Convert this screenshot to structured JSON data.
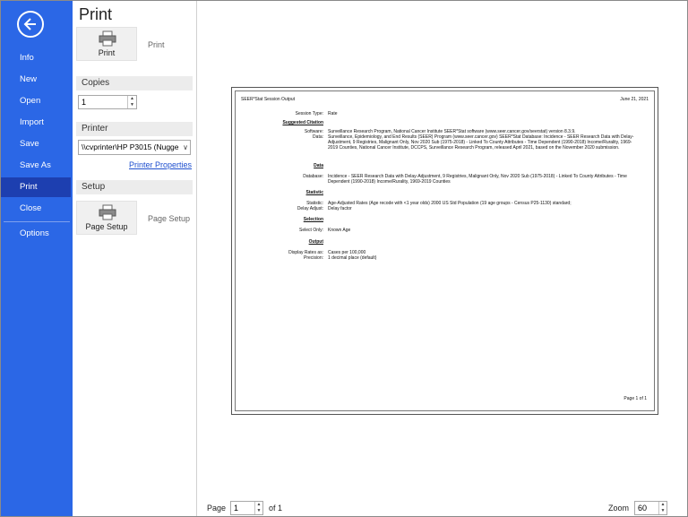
{
  "nav": {
    "items": [
      {
        "label": "Info"
      },
      {
        "label": "New"
      },
      {
        "label": "Open"
      },
      {
        "label": "Import"
      },
      {
        "label": "Save"
      },
      {
        "label": "Save As"
      },
      {
        "label": "Print",
        "active": true
      },
      {
        "label": "Close"
      },
      {
        "label": "Options"
      }
    ],
    "back_icon": "back-arrow-icon"
  },
  "panel": {
    "title": "Print",
    "print_button": "Print",
    "print_side_label": "Print",
    "copies_header": "Copies",
    "copies_value": "1",
    "printer_header": "Printer",
    "printer_selected": "\\\\cvprinter\\HP P3015 (Nugge",
    "printer_properties": "Printer Properties",
    "setup_header": "Setup",
    "page_setup_button": "Page Setup",
    "page_setup_side_label": "Page Setup"
  },
  "preview": {
    "page_header_left": "SEER*Stat Session Output",
    "page_header_right": "June 21, 2021",
    "session_type_label": "Session Type:",
    "session_type_value": "Rate",
    "suggested_citation": "Suggested Citation",
    "software_label": "Software:",
    "software_value": "Surveillance Research Program, National Cancer Institute SEER*Stat software (www.seer.cancer.gov/seerstat) version 8.3.9.",
    "data_label": "Data:",
    "data_value": "Surveillance, Epidemiology, and End Results (SEER) Program (www.seer.cancer.gov) SEER*Stat Database: Incidence - SEER Research Data with Delay-Adjustment, 9 Registries, Malignant Only, Nov 2020 Sub (1975-2018) - Linked To County Attributes - Time Dependent (1990-2018) Income/Rurality, 1969-2019 Counties, National Cancer Institute, DCCPS, Surveillance Research Program, released April 2021, based on the November 2020 submission.",
    "data_header": "Data",
    "database_label": "Database:",
    "database_value": "Incidence - SEER Research Data with Delay-Adjustment, 9 Registries, Malignant Only, Nov 2020 Sub (1975-2018) - Linked To County Attributes - Time Dependent (1990-2018) Income/Rurality, 1969-2019 Counties",
    "statistic_header": "Statistic",
    "statistic_label": "Statistic:",
    "statistic_value": "Age-Adjusted Rates (Age recode with <1 year olds) 2000 US Std Population (19 age groups - Census P25-1130) standard;",
    "delay_label": "Delay Adjust:",
    "delay_value": "Delay factor",
    "selection_header": "Selection",
    "select_only_label": "Select Only:",
    "select_only_value": "Known Age",
    "output_header": "Output",
    "display_rates_label": "Display Rates as:",
    "display_rates_value": "Cases per 100,000",
    "precision_label": "Precision:",
    "precision_value": "1 decimal place (default)",
    "page_footer": "Page 1 of 1"
  },
  "footer": {
    "page_label": "Page",
    "page_value": "1",
    "of_label": "of 1",
    "zoom_label": "Zoom",
    "zoom_value": "60"
  }
}
